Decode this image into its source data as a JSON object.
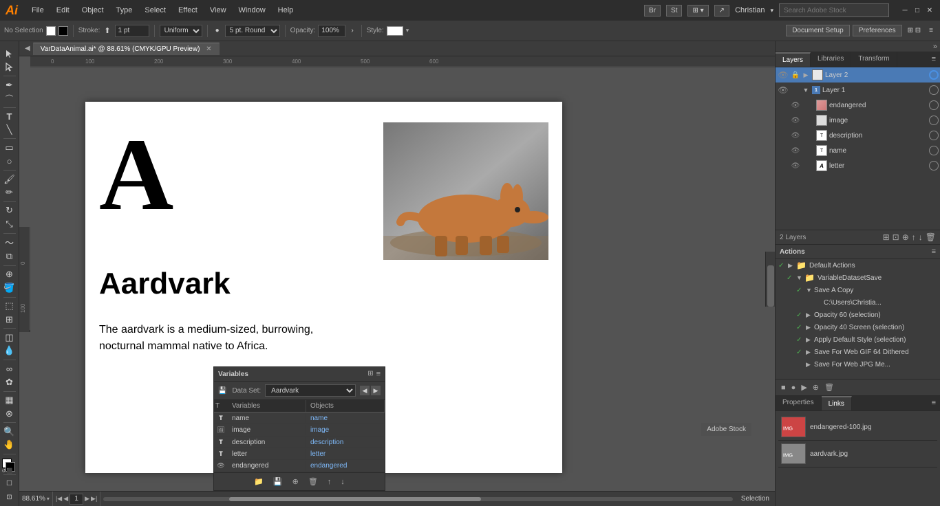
{
  "app": {
    "logo": "Ai",
    "title": "Adobe Illustrator"
  },
  "titlebar": {
    "menus": [
      "File",
      "Edit",
      "Object",
      "Type",
      "Select",
      "Effect",
      "View",
      "Window",
      "Help"
    ],
    "bridge_label": "Br",
    "stock_label": "St",
    "workspace_label": "⊞",
    "share_label": "🔗",
    "user": "Christian",
    "user_dropdown": "▾",
    "search_placeholder": "Search Adobe Stock",
    "window_minimize": "─",
    "window_maximize": "□",
    "window_close": "✕"
  },
  "toolbar": {
    "no_selection": "No Selection",
    "fill_label": "",
    "stroke_label": "Stroke:",
    "stroke_value": "1 pt",
    "uniform_label": "Uniform",
    "brush_label": "5 pt. Round",
    "opacity_label": "Opacity:",
    "opacity_value": "100%",
    "style_label": "Style:",
    "document_setup": "Document Setup",
    "preferences": "Preferences",
    "right_controls": "⊞ ⊟ ≡"
  },
  "tabs": {
    "active_tab": "VarDataAnimal.ai* @ 88.61% (CMYK/GPU Preview)"
  },
  "canvas": {
    "letter": "A",
    "animal_name": "Aardvark",
    "description": "The aardvark is a medium-sized, burrowing, nocturnal mammal native to Africa.",
    "stock_watermark": "Adobe Stock"
  },
  "layers_panel": {
    "tabs": [
      "Layers",
      "Libraries",
      "Transform"
    ],
    "count_label": "2 Layers",
    "layers": [
      {
        "id": "layer2",
        "name": "Layer 2",
        "level": 0,
        "expanded": false,
        "visible": true,
        "locked": true,
        "circle_color": "blue"
      },
      {
        "id": "layer1",
        "name": "Layer 1",
        "level": 0,
        "expanded": true,
        "visible": true,
        "locked": false,
        "circle_color": "none"
      },
      {
        "id": "endangered",
        "name": "endangered",
        "level": 2,
        "visible": true,
        "circle_color": "none"
      },
      {
        "id": "image",
        "name": "image",
        "level": 2,
        "visible": true,
        "circle_color": "none"
      },
      {
        "id": "description",
        "name": "description",
        "level": 2,
        "visible": true,
        "circle_color": "none"
      },
      {
        "id": "name",
        "name": "name",
        "level": 2,
        "visible": true,
        "circle_color": "none"
      },
      {
        "id": "letter",
        "name": "letter",
        "level": 2,
        "visible": true,
        "circle_color": "none"
      }
    ],
    "footer_icons": [
      "⊞",
      "⊟",
      "⊕",
      "↑",
      "↓",
      "🗑"
    ]
  },
  "actions_panel": {
    "title": "Actions",
    "actions": [
      {
        "checked": true,
        "name": "Default Actions",
        "type": "folder",
        "expanded": true
      },
      {
        "checked": true,
        "name": "VariableDatasetSave",
        "type": "folder",
        "expanded": true,
        "indent": 1
      },
      {
        "checked": true,
        "name": "Save A Copy",
        "type": "action",
        "indent": 2
      },
      {
        "checked": false,
        "name": "C:\\Users\\Christia...",
        "type": "step",
        "indent": 3
      },
      {
        "checked": true,
        "name": "Opacity 60 (selection)",
        "type": "step",
        "indent": 2
      },
      {
        "checked": true,
        "name": "Opacity 40 Screen (selection)",
        "type": "step",
        "indent": 2
      },
      {
        "checked": true,
        "name": "Apply Default Style (selection)",
        "type": "step",
        "indent": 2
      },
      {
        "checked": true,
        "name": "Save For Web GIF 64 Dithered",
        "type": "step",
        "indent": 2
      },
      {
        "checked": false,
        "name": "Save For Web JPG Me...",
        "type": "step",
        "indent": 2
      }
    ],
    "footer_buttons": [
      "■",
      "▶",
      "●",
      "⊕",
      "🗑"
    ]
  },
  "properties_panel": {
    "tabs": [
      "Properties",
      "Links"
    ],
    "links": [
      {
        "filename": "endangered-100.jpg",
        "thumb": "img1"
      },
      {
        "filename": "aardvark.jpg",
        "thumb": "img2"
      }
    ]
  },
  "variables_panel": {
    "title": "Variables",
    "dataset_label": "Data Set:",
    "dataset_value": "Aardvark",
    "columns": [
      "T",
      "Variables",
      "Objects"
    ],
    "rows": [
      {
        "type": "T",
        "variable": "name",
        "object": "name"
      },
      {
        "type": "img",
        "variable": "image",
        "object": "image"
      },
      {
        "type": "T",
        "variable": "description",
        "object": "description"
      },
      {
        "type": "T",
        "variable": "letter",
        "object": "letter"
      },
      {
        "type": "eye",
        "variable": "endangered",
        "object": "endangered"
      }
    ],
    "footer_buttons": [
      "📁",
      "⊕",
      "🗑",
      "↑",
      "↓"
    ]
  },
  "statusbar": {
    "zoom": "88.61%",
    "zoom_dropdown": "▾",
    "nav_prev": "◀",
    "page_num": "1",
    "page_dropdown": "▾",
    "nav_next": "▶",
    "selection": "Selection"
  }
}
